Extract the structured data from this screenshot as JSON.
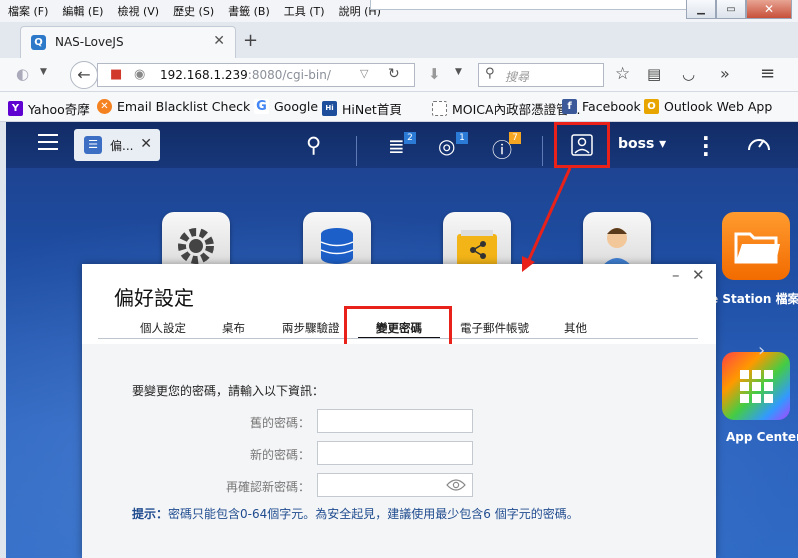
{
  "browser": {
    "menu": [
      "檔案 (F)",
      "編輯 (E)",
      "檢視 (V)",
      "歷史 (S)",
      "書籤 (B)",
      "工具 (T)",
      "說明 (H)"
    ],
    "tab_title": "NAS-LoveJS",
    "new_tab": "+",
    "url_host": "192.168.1.239",
    "url_path": ":8080/cgi-bin/",
    "search_placeholder": "搜尋",
    "bookmarks": [
      {
        "label": "Yahoo奇摩",
        "icon": "yahoo-icon",
        "color": "#5f01d1"
      },
      {
        "label": "Email Blacklist Check ...",
        "icon": "blacklist-icon",
        "color": "#f58220"
      },
      {
        "label": "Google",
        "icon": "google-icon",
        "color": "#4285f4"
      },
      {
        "label": "HiNet首頁",
        "icon": "hinet-icon",
        "color": "#1d4e9c"
      },
      {
        "label": "MOICA內政部憑證管...",
        "icon": "moica-icon",
        "color": "#ffffff"
      },
      {
        "label": "Facebook",
        "icon": "facebook-icon",
        "color": "#3b5998"
      },
      {
        "label": "Outlook Web App",
        "icon": "outlook-icon",
        "color": "#e8a500"
      }
    ]
  },
  "qnap": {
    "app_tab_label": "偏...",
    "badges": {
      "tasks": "2",
      "notifications": "1",
      "info": "7"
    },
    "username": "boss",
    "side_apps": [
      {
        "label": "e Station 檔案",
        "icon": "file-station-icon"
      },
      {
        "label": "App Center",
        "icon": "app-center-icon"
      }
    ]
  },
  "dialog": {
    "title": "偏好設定",
    "tabs": [
      "個人設定",
      "桌布",
      "兩步驟驗證",
      "變更密碼",
      "電子郵件帳號",
      "其他"
    ],
    "active_tab": "變更密碼",
    "instruction": "要變更您的密碼，請輸入以下資訊：",
    "fields": [
      {
        "label": "舊的密碼：",
        "value": ""
      },
      {
        "label": "新的密碼：",
        "value": ""
      },
      {
        "label": "再確認新密碼：",
        "value": ""
      }
    ],
    "hint_label": "提示：",
    "hint_text": "密碼只能包含0-64個字元。為安全起見，建議使用最少包含6 個字元的密碼。"
  },
  "colors": {
    "highlight": "#e8211a",
    "topbar": "#122c66",
    "badge_blue": "#2b7bd6",
    "badge_orange": "#f5a623"
  }
}
